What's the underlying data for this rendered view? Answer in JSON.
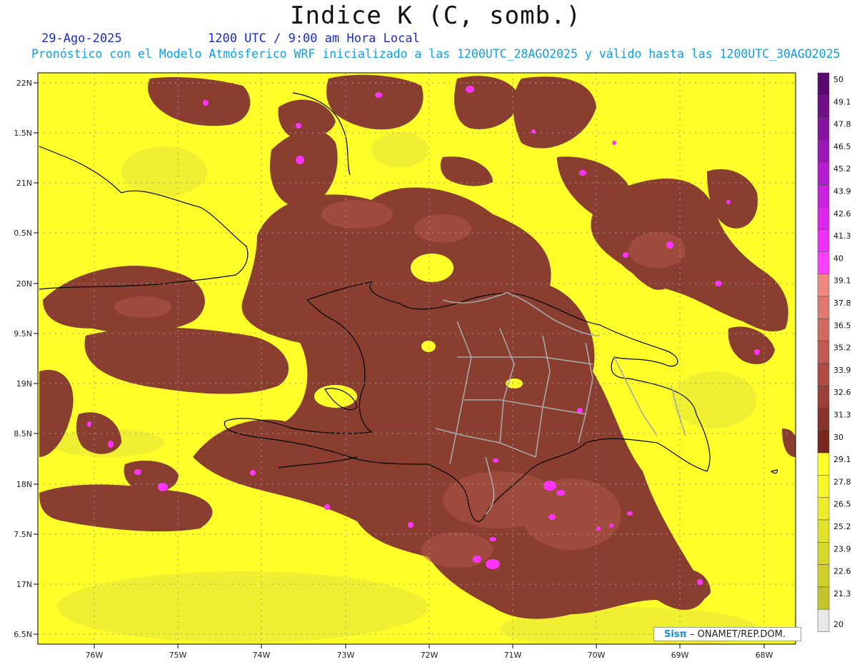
{
  "header": {
    "title": "Indice K (C, somb.)",
    "date": "29-Ago-2025",
    "time": "1200 UTC / 9:00 am Hora Local",
    "subtitle": "Pronóstico con el Modelo Atmósferico WRF inicializado a las 1200UTC_28AGO2025 y válido hasta las  1200UTC_30AGO2025"
  },
  "axes": {
    "lat_labels": [
      "22N",
      "1.5N",
      "21N",
      "0.5N",
      "20N",
      "9.5N",
      "19N",
      "8.5N",
      "18N",
      "7.5N",
      "17N",
      "6.5N"
    ],
    "lon_labels": [
      "76W",
      "75W",
      "74W",
      "73W",
      "72W",
      "71W",
      "70W",
      "69W",
      "68W"
    ]
  },
  "colorbar": {
    "labels": [
      "50",
      "49.1",
      "47.8",
      "46.5",
      "45.2",
      "43.9",
      "42.6",
      "41.3",
      "40",
      "39.1",
      "37.8",
      "36.5",
      "35.2",
      "33.9",
      "32.6",
      "31.3",
      "30",
      "29.1",
      "27.8",
      "26.5",
      "25.2",
      "23.9",
      "22.6",
      "21.3",
      "20"
    ],
    "colors": [
      "#5a0a6e",
      "#6e0f87",
      "#85139e",
      "#9c18b5",
      "#b21dcc",
      "#c822dd",
      "#dd28ec",
      "#f030f8",
      "#ff40ff",
      "#f08a80",
      "#e07a70",
      "#cf6a60",
      "#bf5b52",
      "#ae4c44",
      "#9c3f38",
      "#8a322c",
      "#7a2620",
      "#ffff2a",
      "#f6f62a",
      "#ecec2c",
      "#e2e22c",
      "#d8d82c",
      "#cece2c",
      "#c4c42c",
      "#e8e8e8"
    ]
  },
  "credit": {
    "logo_text": "Sisπ",
    "text": "– ONAMET/REP.DOM."
  },
  "colors": {
    "yellow": "#ffff2a",
    "brown": "#8a3e30",
    "magenta": "#ff33ff"
  }
}
